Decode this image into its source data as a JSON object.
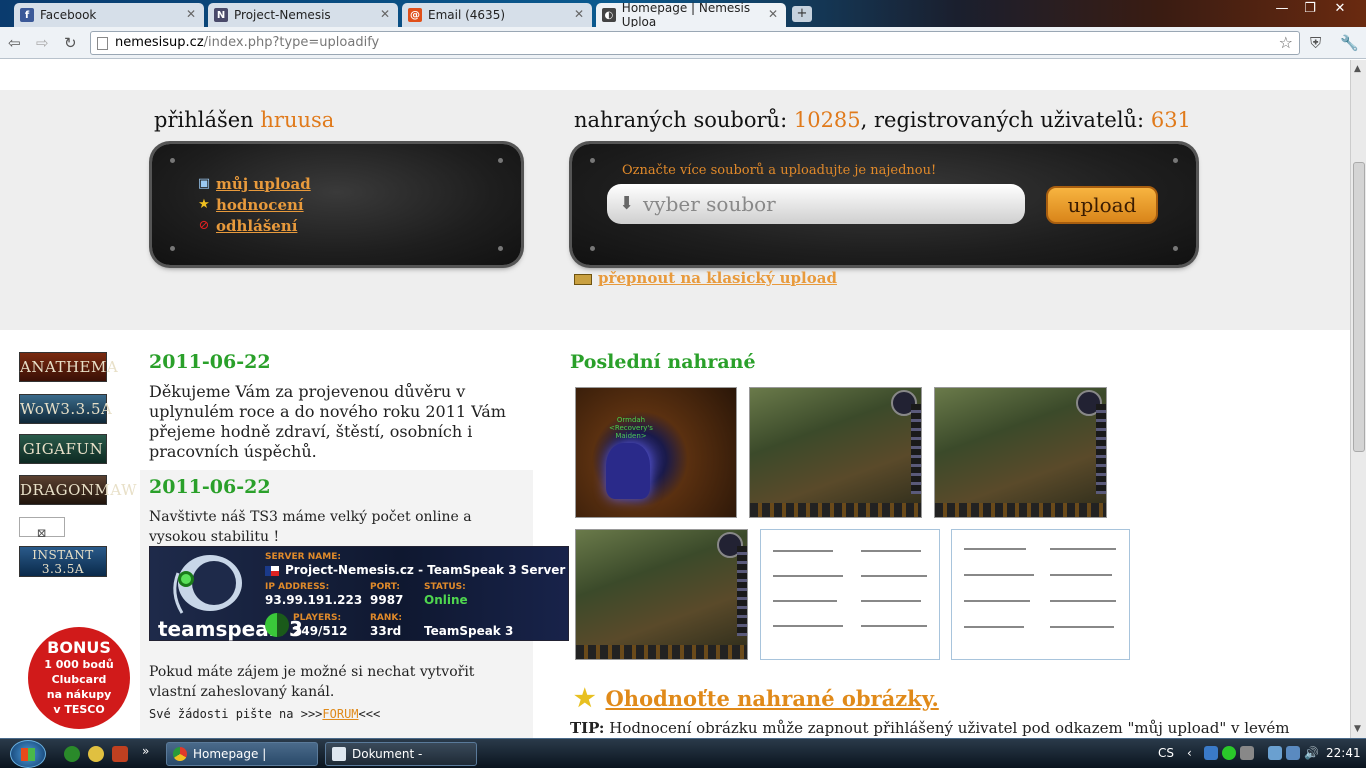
{
  "browser": {
    "tabs": [
      {
        "title": "Facebook",
        "favicon": "f",
        "color": "#3b5998"
      },
      {
        "title": "Project-Nemesis",
        "favicon": "N",
        "color": "#4a4a6a"
      },
      {
        "title": "Email (4635)",
        "favicon": "@",
        "color": "#e0501a"
      },
      {
        "title": "Homepage | Nemesis Uploa",
        "favicon": "◐",
        "color": "#444"
      }
    ],
    "url_host": "nemesisup.cz",
    "url_path": "/index.php?type=uploadify"
  },
  "header": {
    "login_prefix": "přihlášen",
    "username": "hruusa",
    "stats_files_label": "nahraných souborů:",
    "stats_files": "10285",
    "stats_users_label": ", registrovaných uživatelů:",
    "stats_users": "631"
  },
  "user_menu": {
    "my_upload": "můj upload",
    "rating": "hodnocení",
    "logout": "odhlášení"
  },
  "upload": {
    "hint": "Označte více souborů a uploadujte je  najednou!",
    "placeholder": "vyber soubor",
    "button": "upload",
    "classic_link": "přepnout na klasický upload"
  },
  "banners": [
    "ANATHEMA",
    "WoW3.3.5A",
    "GIGAFUN",
    "DRAGONMAW",
    "",
    "INSTANT 3.3.5A"
  ],
  "bonus": {
    "line1": "BONUS",
    "line2": "1 000 bodů",
    "line3": "Clubcard",
    "line4": "na nákupy",
    "line5": "v TESCO"
  },
  "news": [
    {
      "date": "2011-06-22",
      "text": "Děkujeme Vám za projevenou důvěru v uplynulém roce a do nového roku 2011  Vám přejeme hodně zdraví, štěstí, osobních i pracovních úspěchů."
    },
    {
      "date": "2011-06-22",
      "text": "Navštivte náš TS3 máme velký počet online a vysokou stabilitu !",
      "text2": "Pokud máte zájem je možné si nechat vytvořit vlastní zaheslovaný kanál.",
      "mono_prefix": "Své žádosti pište na >>>",
      "mono_link": "FORUM",
      "mono_suffix": "<<<"
    }
  ],
  "teamspeak": {
    "logo_text": "teamspeak 3",
    "server_name_label": "SERVER NAME:",
    "server_name": "Project-Nemesis.cz - TeamSpeak 3 Server",
    "ip_label": "IP ADDRESS:",
    "ip": "93.99.191.223",
    "port_label": "PORT:",
    "port": "9987",
    "status_label": "STATUS:",
    "status": "Online",
    "players_label": "PLAYERS:",
    "players": "249/512",
    "rank_label": "RANK:",
    "rank": "33rd",
    "product": "TeamSpeak 3"
  },
  "recent": {
    "title": "Poslední nahrané",
    "thumb_caption": "Ormdah <Recovery's Maiden>"
  },
  "rating": {
    "link": "Ohodnoťte nahrané obrázky.",
    "tip_label": "TIP:",
    "tip_text": " Hodnocení obrázku může zapnout přihlášený uživatel pod odkazem \"můj upload\" v levém"
  },
  "taskbar": {
    "tasks": [
      {
        "title": "Homepage | Nemes..."
      },
      {
        "title": "Dokument - WordPad"
      }
    ],
    "lang": "CS",
    "time": "22:41"
  }
}
